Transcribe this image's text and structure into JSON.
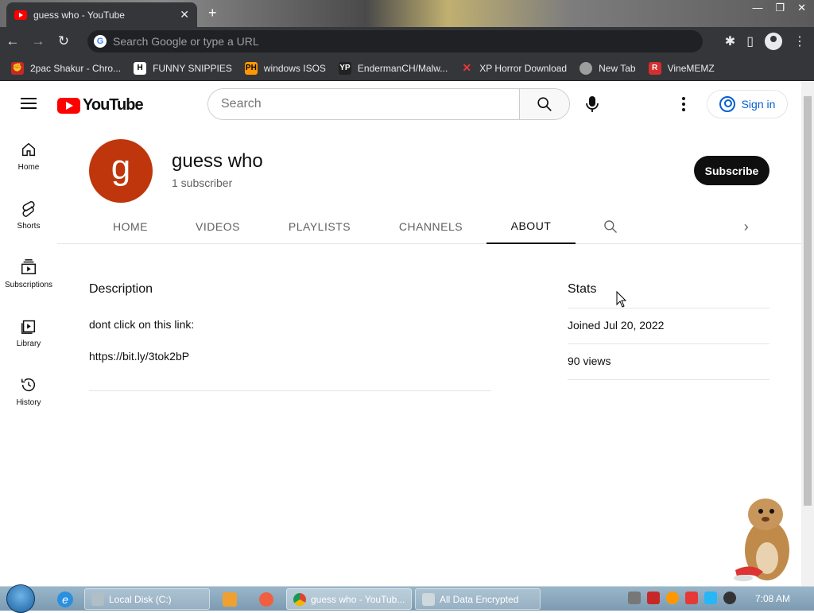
{
  "browser": {
    "tab_title": "guess who - YouTube",
    "omnibox_placeholder": "Search Google or type a URL",
    "bookmarks": [
      {
        "label": "2pac Shakur - Chro...",
        "icon": "fist-icon",
        "color": "#c62828"
      },
      {
        "label": "FUNNY SNIPPIES",
        "icon": "h-icon",
        "color": "#ffffff"
      },
      {
        "label": "windows ISOS",
        "icon": "ph-icon",
        "color": "#ff9800"
      },
      {
        "label": "EndermanCH/Malw...",
        "icon": "yp-icon",
        "color": "#222222"
      },
      {
        "label": "XP Horror Download",
        "icon": "x-icon",
        "color": "#e53935"
      },
      {
        "label": "New Tab",
        "icon": "globe-icon",
        "color": "#9e9e9e"
      },
      {
        "label": "VineMEMZ",
        "icon": "r-icon",
        "color": "#d32f2f"
      }
    ]
  },
  "youtube": {
    "logo_text": "YouTube",
    "search_placeholder": "Search",
    "sign_in": "Sign in",
    "guide": [
      {
        "label": "Home",
        "icon": "home-icon"
      },
      {
        "label": "Shorts",
        "icon": "shorts-icon"
      },
      {
        "label": "Subscriptions",
        "icon": "subscriptions-icon"
      },
      {
        "label": "Library",
        "icon": "library-icon"
      },
      {
        "label": "History",
        "icon": "history-icon"
      }
    ],
    "channel": {
      "avatar_letter": "g",
      "avatar_color": "#bf360c",
      "name": "guess who",
      "subscribers": "1 subscriber",
      "subscribe": "Subscribe"
    },
    "tabs": [
      {
        "label": "HOME"
      },
      {
        "label": "VIDEOS"
      },
      {
        "label": "PLAYLISTS"
      },
      {
        "label": "CHANNELS"
      },
      {
        "label": "ABOUT",
        "active": true
      }
    ],
    "about": {
      "description_title": "Description",
      "description_line1": "dont click on this link:",
      "description_line2": "https://bit.ly/3tok2bP",
      "stats_title": "Stats",
      "stats": [
        "Joined Jul 20, 2022",
        "90 views"
      ]
    }
  },
  "taskbar": {
    "items": [
      "Local Disk (C:)",
      "guess who - YouTub...",
      "All Data Encrypted"
    ],
    "clock": "7:08 AM"
  }
}
